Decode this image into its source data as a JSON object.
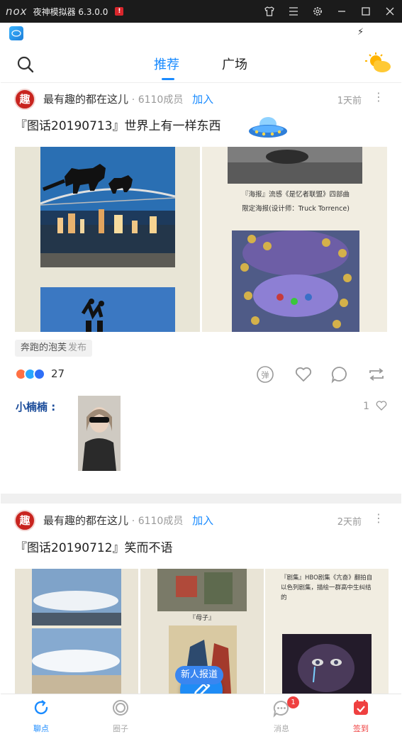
{
  "window": {
    "title": "夜神模拟器 6.3.0.0",
    "brand": "nox"
  },
  "nav": {
    "tabs": [
      {
        "label": "推荐"
      },
      {
        "label": "广场"
      }
    ]
  },
  "posts": [
    {
      "group": "最有趣的都在这儿",
      "avatar_char": "趣",
      "members": "· 6110成员",
      "join": "加入",
      "time": "1天前",
      "title": "『图话20190713』世界上有一样东西",
      "tag_author": "奔跑的泡芙",
      "tag_action": "发布",
      "reaction_count": "27",
      "comment": {
        "author": "小楠楠 :",
        "likes": "1"
      }
    },
    {
      "group": "最有趣的都在这儿",
      "avatar_char": "趣",
      "members": "· 6110成员",
      "join": "加入",
      "time": "2天前",
      "title": "『图话20190712』笑而不语",
      "image_text": [
        "『海报』流感《是忆者联盟》四部曲",
        "限定海报(设计师：Truck Torrence)",
        "『剧集』HBO剧集《亢奋》翻拍自以色列剧集，描绘一群高中生纠结的",
        "『母子』"
      ]
    }
  ],
  "bottom_nav": {
    "items": [
      {
        "label": "聊点",
        "color": "#1a8bff"
      },
      {
        "label": "圈子",
        "color": "#aaa"
      },
      {
        "label": "消息",
        "color": "#aaa"
      },
      {
        "label": "签到",
        "color": "#ef4040"
      }
    ],
    "badge": "1",
    "fab_tooltip": "新人报道"
  },
  "colors": {
    "accent": "#1a8bff",
    "badge": "#ef4040"
  }
}
